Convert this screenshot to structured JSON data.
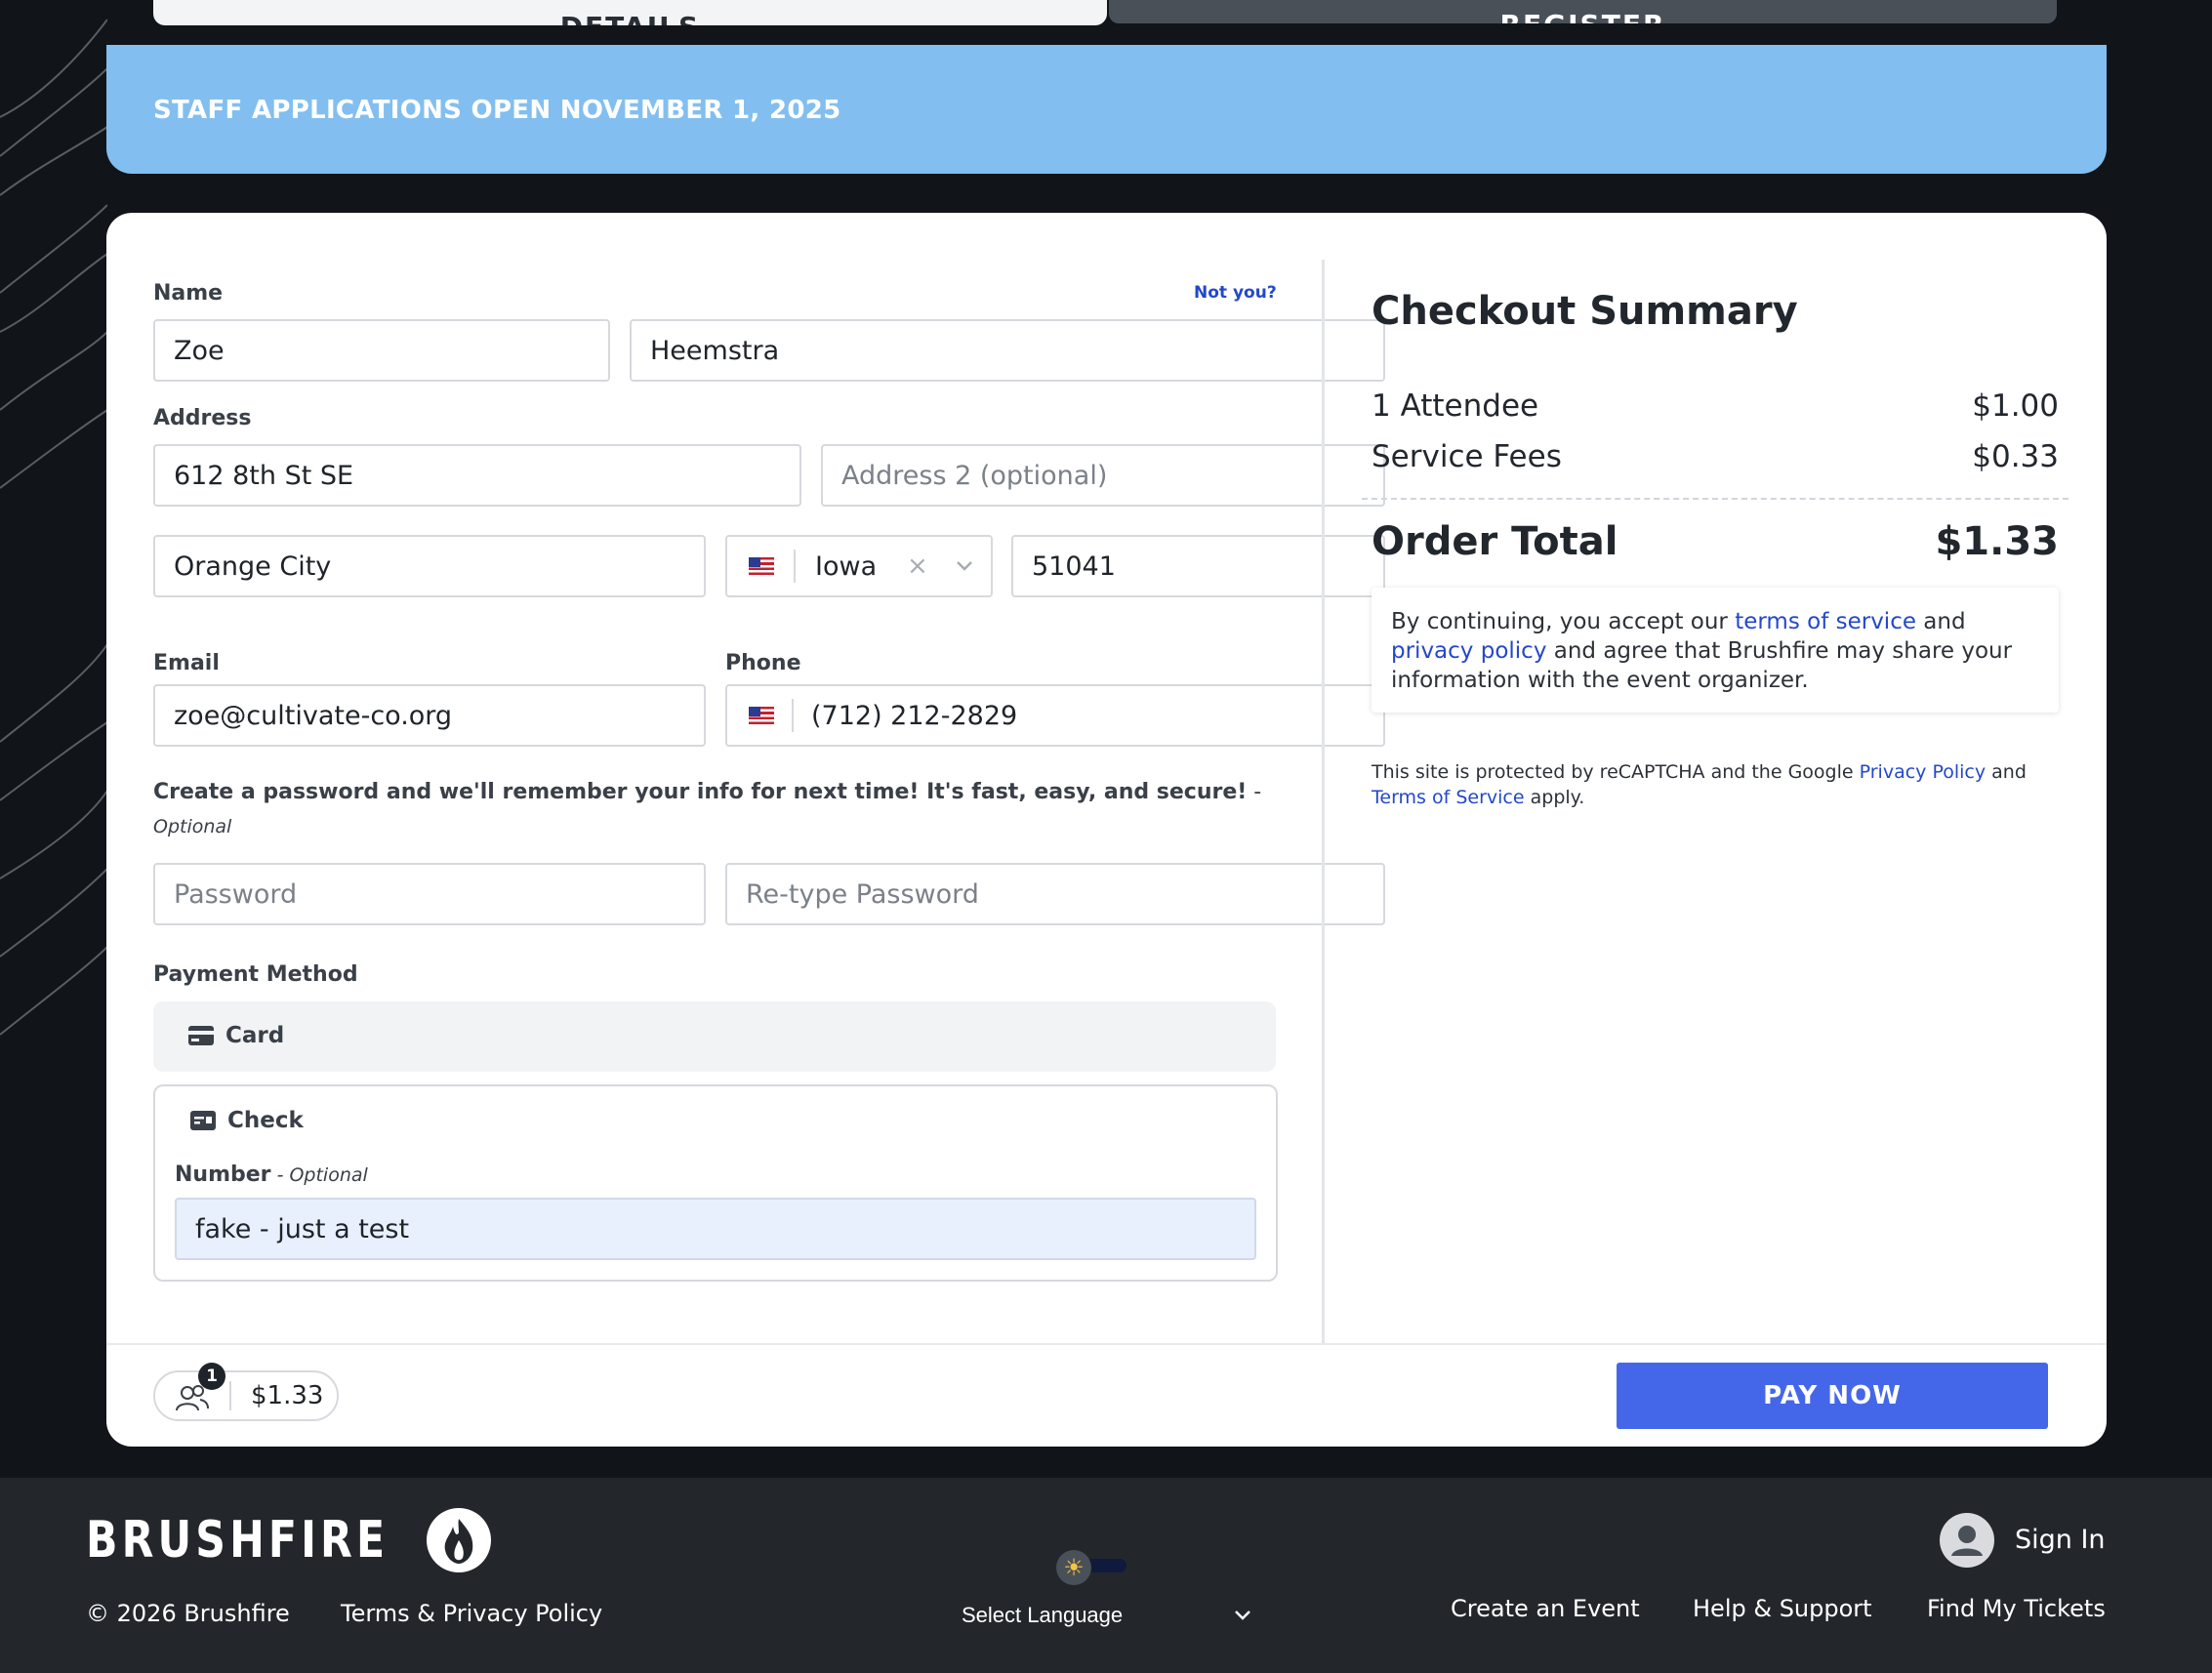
{
  "tabs": {
    "details": "DETAILS",
    "register": "REGISTER"
  },
  "banner": {
    "text": "STAFF APPLICATIONS OPEN NOVEMBER 1, 2025"
  },
  "form": {
    "name_label": "Name",
    "not_you": "Not you?",
    "first_name": "Zoe",
    "last_name": "Heemstra",
    "address_label": "Address",
    "address1": "612 8th St SE",
    "address2_placeholder": "Address 2 (optional)",
    "city": "Orange City",
    "state": "Iowa",
    "zip": "51041",
    "email_label": "Email",
    "email": "zoe@cultivate-co.org",
    "phone_label": "Phone",
    "phone": "(712) 212-2829",
    "password_prompt": "Create a password and we'll remember your info for next time! It's fast, easy, and secure!",
    "password_prompt_suffix": " -",
    "optional": "Optional",
    "password_placeholder": "Password",
    "retype_placeholder": "Re-type Password",
    "payment_label": "Payment Method",
    "card_label": "Card",
    "check_label": "Check",
    "number_label": "Number",
    "number_optional": " - Optional",
    "check_number": "fake - just a test"
  },
  "summary": {
    "title": "Checkout Summary",
    "rows": [
      {
        "label": "1 Attendee",
        "value": "$1.00"
      },
      {
        "label": "Service Fees",
        "value": "$0.33"
      }
    ],
    "total_label": "Order Total",
    "total_value": "$1.33",
    "tos_prefix": "By continuing, you accept our ",
    "tos_link": "terms of service",
    "tos_and": " and ",
    "privacy_link": "privacy policy",
    "tos_suffix": " and agree that Brushfire may share your information with the event organizer.",
    "recaptcha_prefix": "This site is protected by reCAPTCHA and the Google ",
    "recaptcha_privacy": "Privacy Policy",
    "recaptcha_and": " and ",
    "recaptcha_terms": "Terms of Service",
    "recaptcha_suffix": " apply."
  },
  "bottom_bar": {
    "attendee_count": "1",
    "cart_total": "$1.33",
    "pay_button": "PAY NOW"
  },
  "footer": {
    "brand": "BRUSHFIRE",
    "copyright": "© 2026 Brushfire",
    "terms": "Terms & Privacy Policy",
    "language": "Select Language",
    "sign_in": "Sign In",
    "create_event": "Create an Event",
    "help": "Help & Support",
    "find_tickets": "Find My Tickets"
  },
  "colors": {
    "banner": "#82bff0",
    "accent": "#4467ea",
    "link": "#2348c9",
    "footer": "#23272c"
  }
}
